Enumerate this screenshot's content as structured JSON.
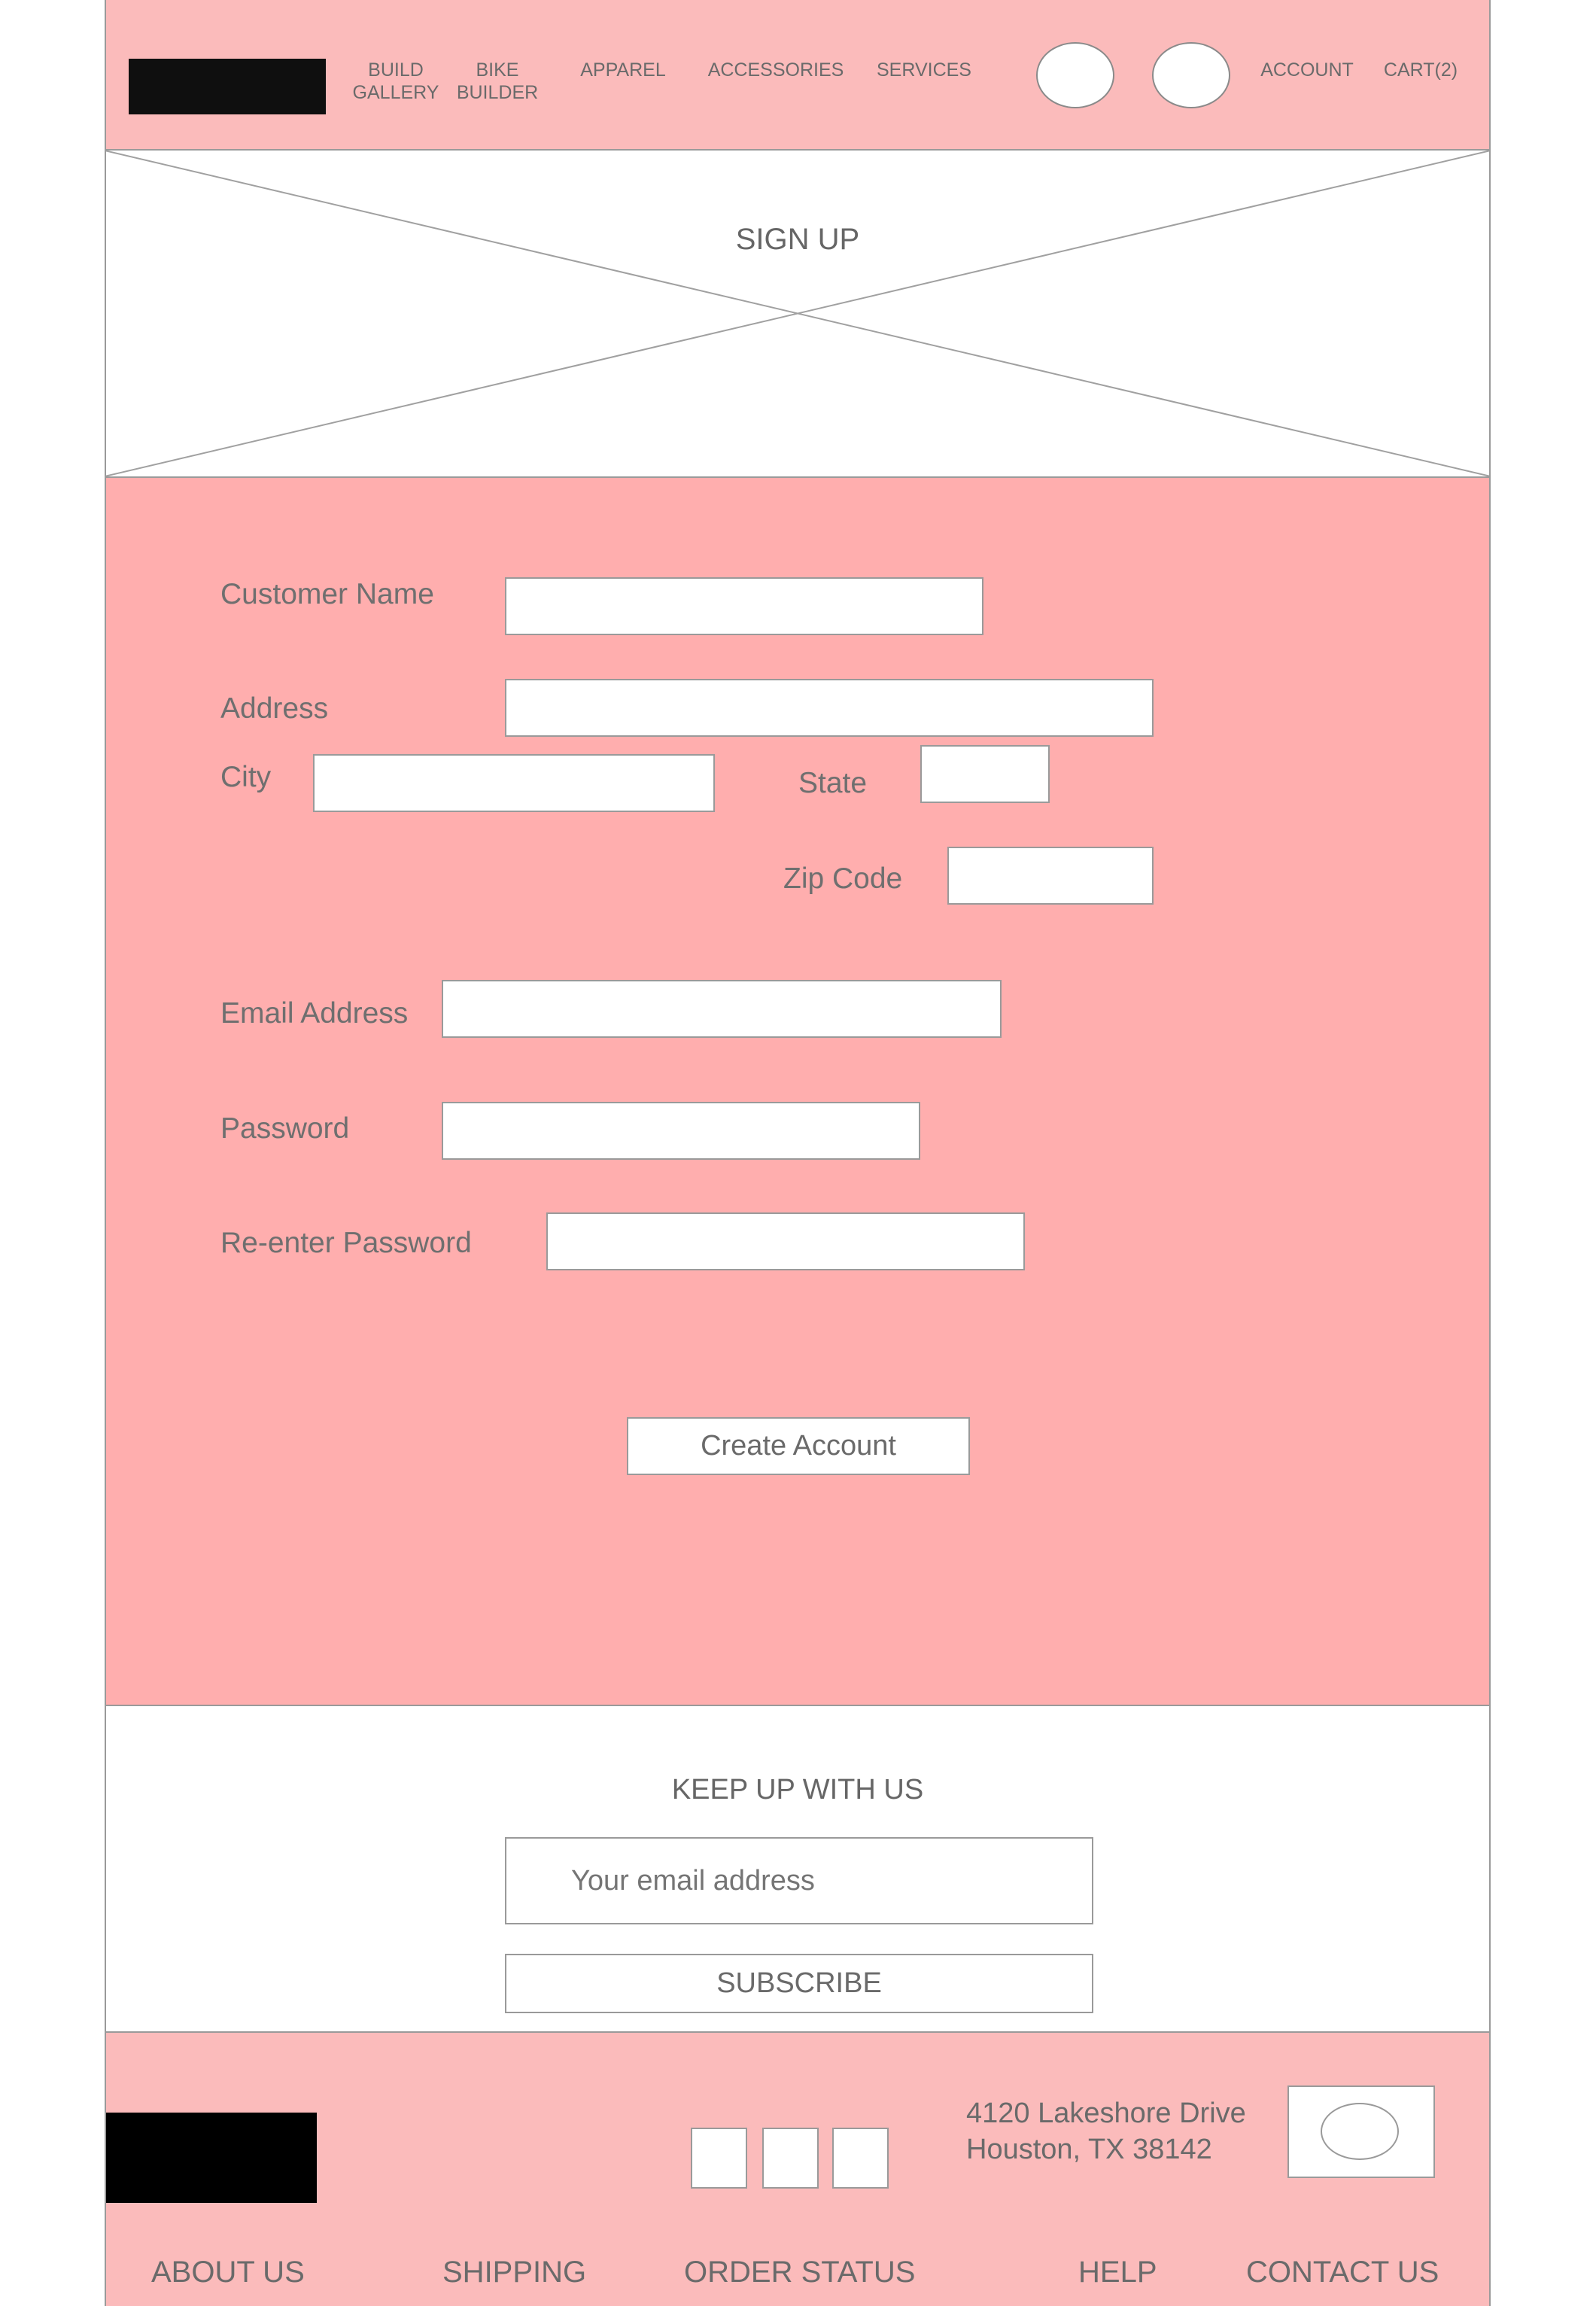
{
  "header": {
    "nav": [
      "BUILD\nGALLERY",
      "BIKE\nBUILDER",
      "APPAREL",
      "ACCESSORIES",
      "SERVICES"
    ],
    "account_label": "ACCOUNT",
    "cart_label": "CART(2)"
  },
  "hero": {
    "title": "SIGN UP"
  },
  "form": {
    "customer_name_label": "Customer Name",
    "address_label": "Address",
    "city_label": "City",
    "state_label": "State",
    "zip_label": "Zip Code",
    "email_label": "Email Address",
    "password_label": "Password",
    "reenter_password_label": "Re-enter Password",
    "create_account_label": "Create Account"
  },
  "newsletter": {
    "title": "KEEP UP WITH US",
    "email_placeholder": "Your email address",
    "subscribe_label": "SUBSCRIBE"
  },
  "footer": {
    "address_line1": "4120 Lakeshore Drive",
    "address_line2": "Houston, TX 38142",
    "links": [
      "ABOUT US",
      "SHIPPING",
      "ORDER STATUS",
      "HELP",
      "CONTACT US"
    ]
  },
  "colors": {
    "header_bg": "#fbbbbb",
    "form_bg": "#ffaeae",
    "footer_bg": "#fbbbbb",
    "logo": "#0f0f0f",
    "border": "#9a9a9a"
  }
}
